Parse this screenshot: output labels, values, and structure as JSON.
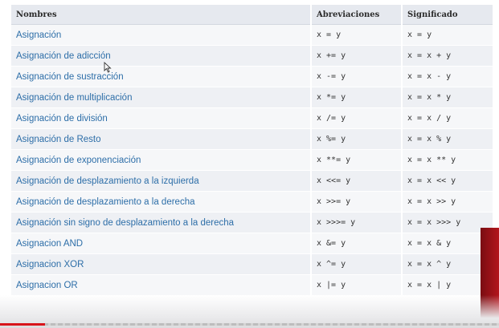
{
  "table": {
    "headers": [
      "Nombres",
      "Abreviaciones",
      "Significado"
    ],
    "rows": [
      {
        "name": "Asignación",
        "abbr": "x = y",
        "meaning": "x = y"
      },
      {
        "name": "Asignación de adicción",
        "abbr": "x += y",
        "meaning": "x = x + y"
      },
      {
        "name": "Asignación de sustracción",
        "abbr": "x -= y",
        "meaning": "x = x - y"
      },
      {
        "name": "Asignación de multiplicación",
        "abbr": "x *= y",
        "meaning": "x = x * y"
      },
      {
        "name": "Asignación de división",
        "abbr": "x /= y",
        "meaning": "x = x / y"
      },
      {
        "name": "Asignación de Resto",
        "abbr": "x %= y",
        "meaning": "x = x % y"
      },
      {
        "name": "Asignación de exponenciación",
        "abbr": "x **= y",
        "meaning": "x = x ** y"
      },
      {
        "name": "Asignación de desplazamiento a la izquierda",
        "abbr": "x <<= y",
        "meaning": "x = x << y"
      },
      {
        "name": "Asignación de desplazamiento a la derecha",
        "abbr": "x >>= y",
        "meaning": "x = x >> y"
      },
      {
        "name": "Asignación sin signo de desplazamiento a la derecha",
        "abbr": "x >>>= y",
        "meaning": "x = x >>> y"
      },
      {
        "name": "Asignacion AND",
        "abbr": "x &= y",
        "meaning": "x = x & y"
      },
      {
        "name": "Asignacion XOR",
        "abbr": "x ^= y",
        "meaning": "x = x ^ y"
      },
      {
        "name": "Asignacion OR",
        "abbr": "x |= y",
        "meaning": "x = x | y"
      }
    ]
  },
  "video_progress": 0.09,
  "colors": {
    "link": "#2d6ea8",
    "header_bg": "#e6e9ef",
    "progress": "#d8141a"
  },
  "icons": {
    "cursor": "mouse-pointer-icon"
  }
}
